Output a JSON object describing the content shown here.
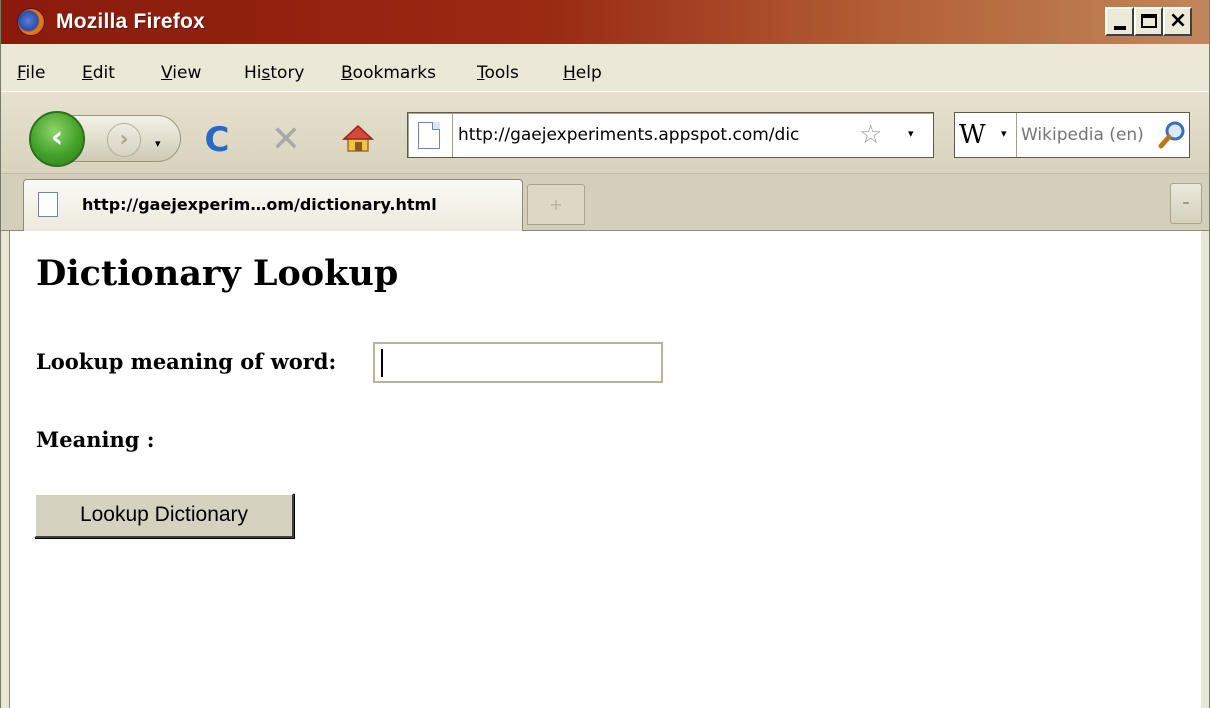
{
  "window": {
    "title": "Mozilla Firefox",
    "controls": {
      "minimize": "_",
      "maximize": "□",
      "close": "×"
    }
  },
  "menubar": {
    "items": [
      {
        "label": "File",
        "accel": "F",
        "rest": "ile"
      },
      {
        "label": "Edit",
        "accel": "E",
        "rest": "dit"
      },
      {
        "label": "View",
        "accel": "V",
        "rest": "iew"
      },
      {
        "label": "History",
        "accel_prefix": "Hi",
        "accel": "s",
        "rest": "tory"
      },
      {
        "label": "Bookmarks",
        "accel": "B",
        "rest": "ookmarks"
      },
      {
        "label": "Tools",
        "accel": "T",
        "rest": "ools"
      },
      {
        "label": "Help",
        "accel": "H",
        "rest": "elp"
      }
    ]
  },
  "toolbar": {
    "back_icon": "back-arrow-icon",
    "forward_icon": "forward-arrow-icon",
    "reload_icon": "reload-icon",
    "stop_icon": "stop-icon",
    "home_icon": "home-icon",
    "back_glyph": "‹",
    "forward_glyph": "›",
    "reload_glyph": "C",
    "stop_glyph": "✕",
    "dropdown_glyph": "▾",
    "url": "http://gaejexperiments.appspot.com/dic",
    "bookmark_star_glyph": "☆",
    "search_engine_glyph": "W",
    "search_placeholder": "Wikipedia (en)"
  },
  "tabs": {
    "items": [
      {
        "label": "http://gaejexperim…om/dictionary.html",
        "active": true
      }
    ],
    "new_tab_glyph": "+",
    "list_all_glyph": "–"
  },
  "page": {
    "heading": "Dictionary Lookup",
    "word_label": "Lookup meaning of word:",
    "word_value": "",
    "meaning_label": "Meaning :",
    "meaning_value": "",
    "lookup_button": "Lookup Dictionary"
  },
  "colors": {
    "titlebar_start": "#8a1a0c",
    "titlebar_end": "#c0875a",
    "chrome_bg": "#ebe8d7",
    "back_button": "#43a22a",
    "reload_blue": "#2a69c6"
  }
}
